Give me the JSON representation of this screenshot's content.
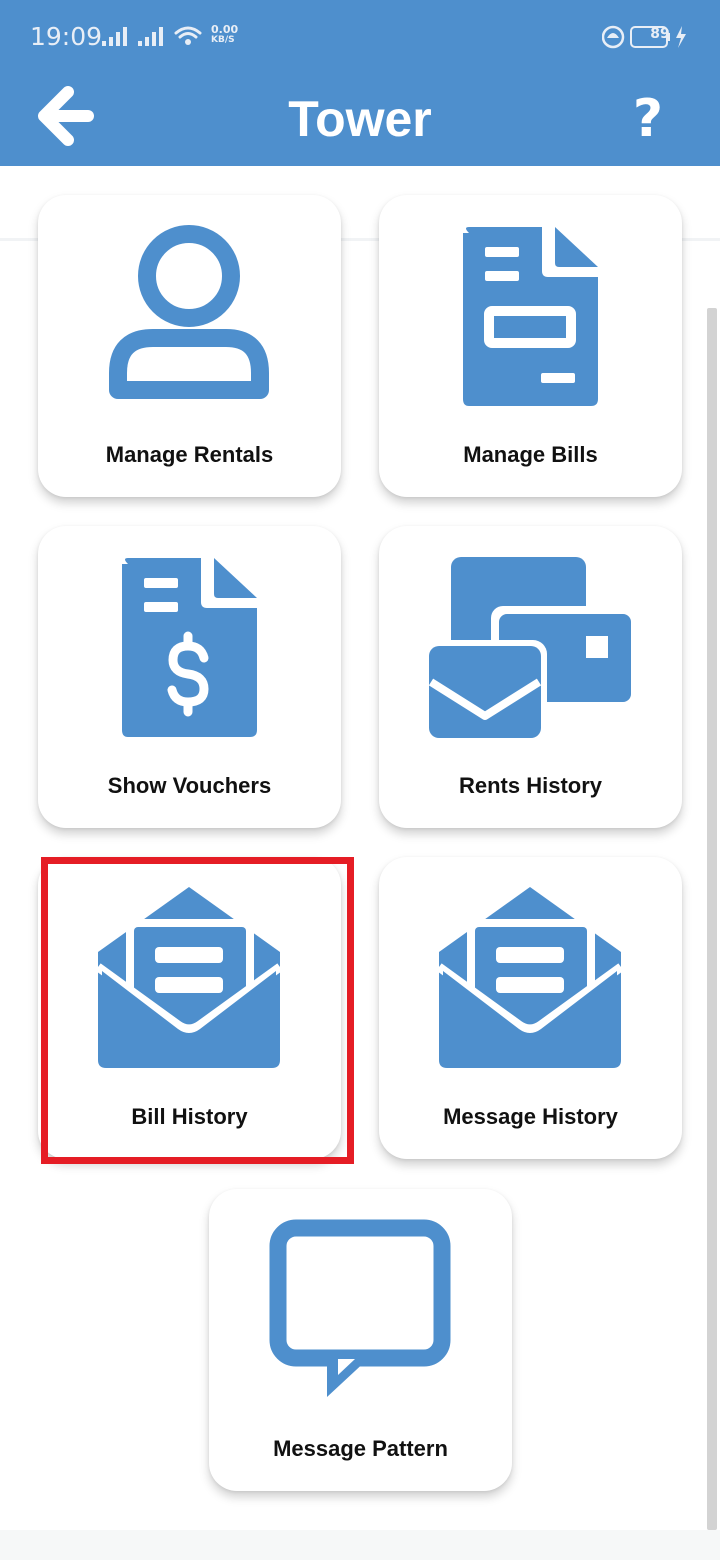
{
  "status_bar": {
    "time": "19:09",
    "network_speed": "0.00",
    "network_unit": "KB/S",
    "battery": "89"
  },
  "app_bar": {
    "title": "Tower",
    "back_icon": "arrow-left-icon",
    "help_label": "?"
  },
  "tiles": [
    {
      "label": "Manage Rentals",
      "icon": "person-icon"
    },
    {
      "label": "Manage Bills",
      "icon": "bill-document-icon"
    },
    {
      "label": "Show Vouchers",
      "icon": "voucher-dollar-icon"
    },
    {
      "label": "Rents History",
      "icon": "mail-cards-icon"
    },
    {
      "label": "Bill History",
      "icon": "open-envelope-icon",
      "selected": true
    },
    {
      "label": "Message History",
      "icon": "open-envelope-icon"
    },
    {
      "label": "Message Pattern",
      "icon": "speech-bubble-icon"
    }
  ],
  "colors": {
    "primary": "#4e8fcd",
    "highlight": "#e51d25",
    "icon": "#4e8fcd"
  }
}
